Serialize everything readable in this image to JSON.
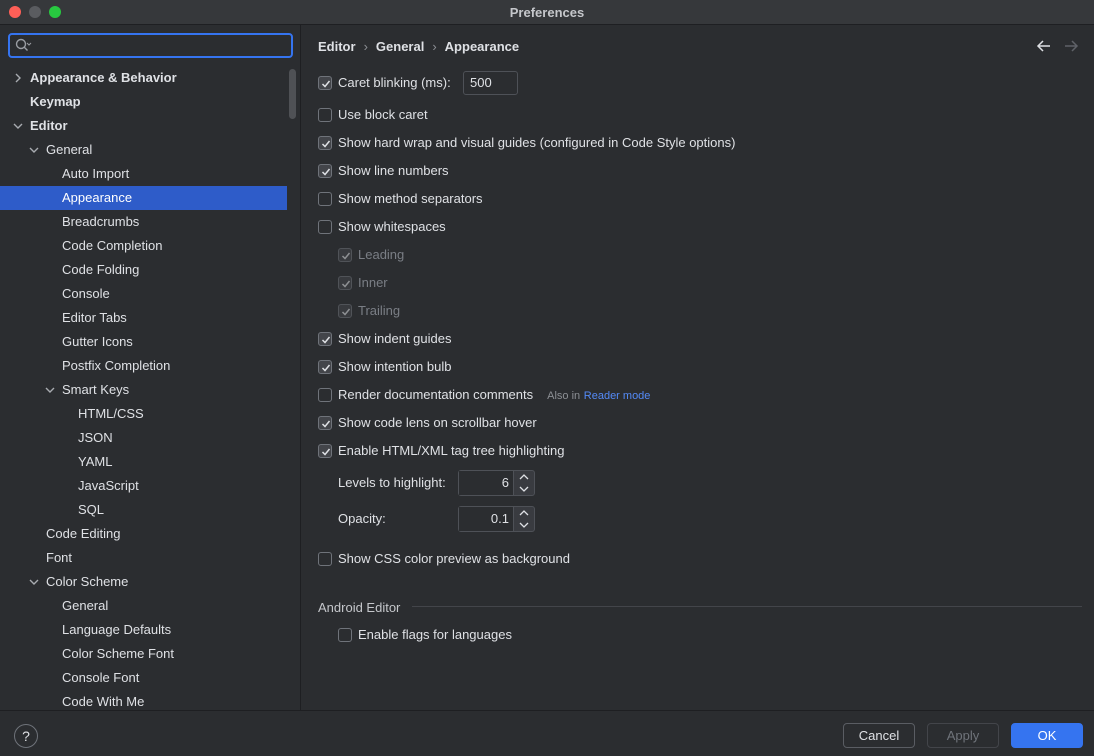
{
  "window": {
    "title": "Preferences"
  },
  "search": {
    "placeholder": ""
  },
  "tree": [
    {
      "label": "Appearance & Behavior",
      "level": 0,
      "bold": true,
      "chevron": "right"
    },
    {
      "label": "Keymap",
      "level": 0,
      "bold": true,
      "chevron": ""
    },
    {
      "label": "Editor",
      "level": 0,
      "bold": true,
      "chevron": "down"
    },
    {
      "label": "General",
      "level": 1,
      "bold": false,
      "chevron": "down"
    },
    {
      "label": "Auto Import",
      "level": 2,
      "bold": false,
      "chevron": ""
    },
    {
      "label": "Appearance",
      "level": 2,
      "bold": false,
      "chevron": "",
      "selected": true
    },
    {
      "label": "Breadcrumbs",
      "level": 2,
      "bold": false,
      "chevron": ""
    },
    {
      "label": "Code Completion",
      "level": 2,
      "bold": false,
      "chevron": ""
    },
    {
      "label": "Code Folding",
      "level": 2,
      "bold": false,
      "chevron": ""
    },
    {
      "label": "Console",
      "level": 2,
      "bold": false,
      "chevron": ""
    },
    {
      "label": "Editor Tabs",
      "level": 2,
      "bold": false,
      "chevron": ""
    },
    {
      "label": "Gutter Icons",
      "level": 2,
      "bold": false,
      "chevron": ""
    },
    {
      "label": "Postfix Completion",
      "level": 2,
      "bold": false,
      "chevron": ""
    },
    {
      "label": "Smart Keys",
      "level": 2,
      "bold": false,
      "chevron": "down"
    },
    {
      "label": "HTML/CSS",
      "level": 3,
      "bold": false,
      "chevron": ""
    },
    {
      "label": "JSON",
      "level": 3,
      "bold": false,
      "chevron": ""
    },
    {
      "label": "YAML",
      "level": 3,
      "bold": false,
      "chevron": ""
    },
    {
      "label": "JavaScript",
      "level": 3,
      "bold": false,
      "chevron": ""
    },
    {
      "label": "SQL",
      "level": 3,
      "bold": false,
      "chevron": ""
    },
    {
      "label": "Code Editing",
      "level": 1,
      "bold": false,
      "chevron": ""
    },
    {
      "label": "Font",
      "level": 1,
      "bold": false,
      "chevron": ""
    },
    {
      "label": "Color Scheme",
      "level": 1,
      "bold": false,
      "chevron": "down"
    },
    {
      "label": "General",
      "level": 2,
      "bold": false,
      "chevron": ""
    },
    {
      "label": "Language Defaults",
      "level": 2,
      "bold": false,
      "chevron": ""
    },
    {
      "label": "Color Scheme Font",
      "level": 2,
      "bold": false,
      "chevron": ""
    },
    {
      "label": "Console Font",
      "level": 2,
      "bold": false,
      "chevron": ""
    },
    {
      "label": "Code With Me",
      "level": 2,
      "bold": false,
      "chevron": ""
    }
  ],
  "breadcrumb": [
    "Editor",
    "General",
    "Appearance"
  ],
  "options": {
    "caret_blinking": {
      "label": "Caret blinking (ms):",
      "checked": true,
      "value": "500"
    },
    "block_caret": {
      "label": "Use block caret",
      "checked": false
    },
    "hard_wrap": {
      "label": "Show hard wrap and visual guides (configured in Code Style options)",
      "checked": true
    },
    "line_numbers": {
      "label": "Show line numbers",
      "checked": true
    },
    "method_separators": {
      "label": "Show method separators",
      "checked": false
    },
    "whitespaces": {
      "label": "Show whitespaces",
      "checked": false
    },
    "leading": {
      "label": "Leading",
      "checked": true,
      "disabled": true
    },
    "inner": {
      "label": "Inner",
      "checked": true,
      "disabled": true
    },
    "trailing": {
      "label": "Trailing",
      "checked": true,
      "disabled": true
    },
    "indent_guides": {
      "label": "Show indent guides",
      "checked": true
    },
    "intention_bulb": {
      "label": "Show intention bulb",
      "checked": true
    },
    "render_docs": {
      "label": "Render documentation comments",
      "checked": false,
      "note": "Also in",
      "link": "Reader mode"
    },
    "code_lens": {
      "label": "Show code lens on scrollbar hover",
      "checked": true
    },
    "tag_tree": {
      "label": "Enable HTML/XML tag tree highlighting",
      "checked": true
    },
    "levels": {
      "label": "Levels to highlight:",
      "value": "6"
    },
    "opacity": {
      "label": "Opacity:",
      "value": "0.1"
    },
    "css_preview": {
      "label": "Show CSS color preview as background",
      "checked": false
    }
  },
  "android": {
    "section_title": "Android Editor",
    "flags": {
      "label": "Enable flags for languages",
      "checked": false
    }
  },
  "footer": {
    "help": "?",
    "cancel": "Cancel",
    "apply": "Apply",
    "ok": "OK"
  },
  "colors": {
    "accent": "#3574f0",
    "selection": "#2e5cc9",
    "link": "#548af7",
    "background": "#2b2d30"
  }
}
